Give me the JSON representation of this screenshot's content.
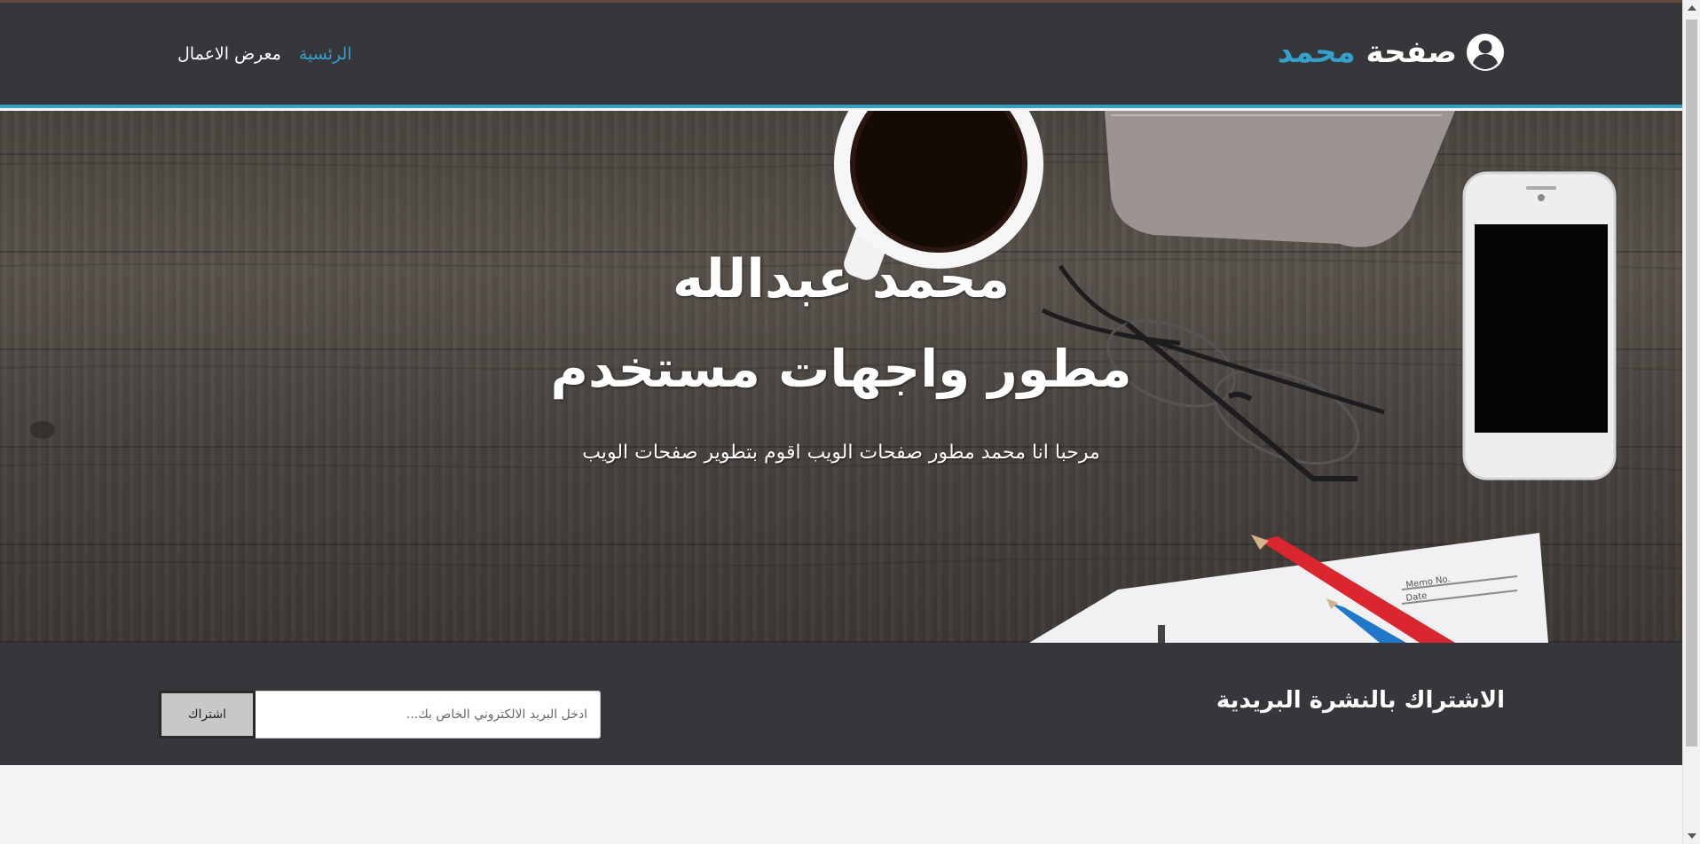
{
  "colors": {
    "header_bg": "#35373a",
    "accent": "#35a0c8",
    "newsletter_bg": "#35373a",
    "page_bg": "#f4f4f4"
  },
  "header": {
    "avatar_icon": "user-circle-icon",
    "brand_prefix": "صفحة",
    "brand_name": "محمد",
    "nav": {
      "home": "الرئسية",
      "portfolio": "معرض الاعمال"
    }
  },
  "hero": {
    "name": "محمد عبدالله",
    "role": "مطور واجهات مستخدم",
    "tagline": "مرحبا انا محمد مطور صفحات الويب اقوم بتطوير صفحات الويب"
  },
  "newsletter": {
    "title": "الاشتراك بالنشرة البريدية",
    "email_placeholder": "ادخل البريد الالكتروني الخاص بك...",
    "email_value": "",
    "subscribe_label": "اشتراك"
  }
}
